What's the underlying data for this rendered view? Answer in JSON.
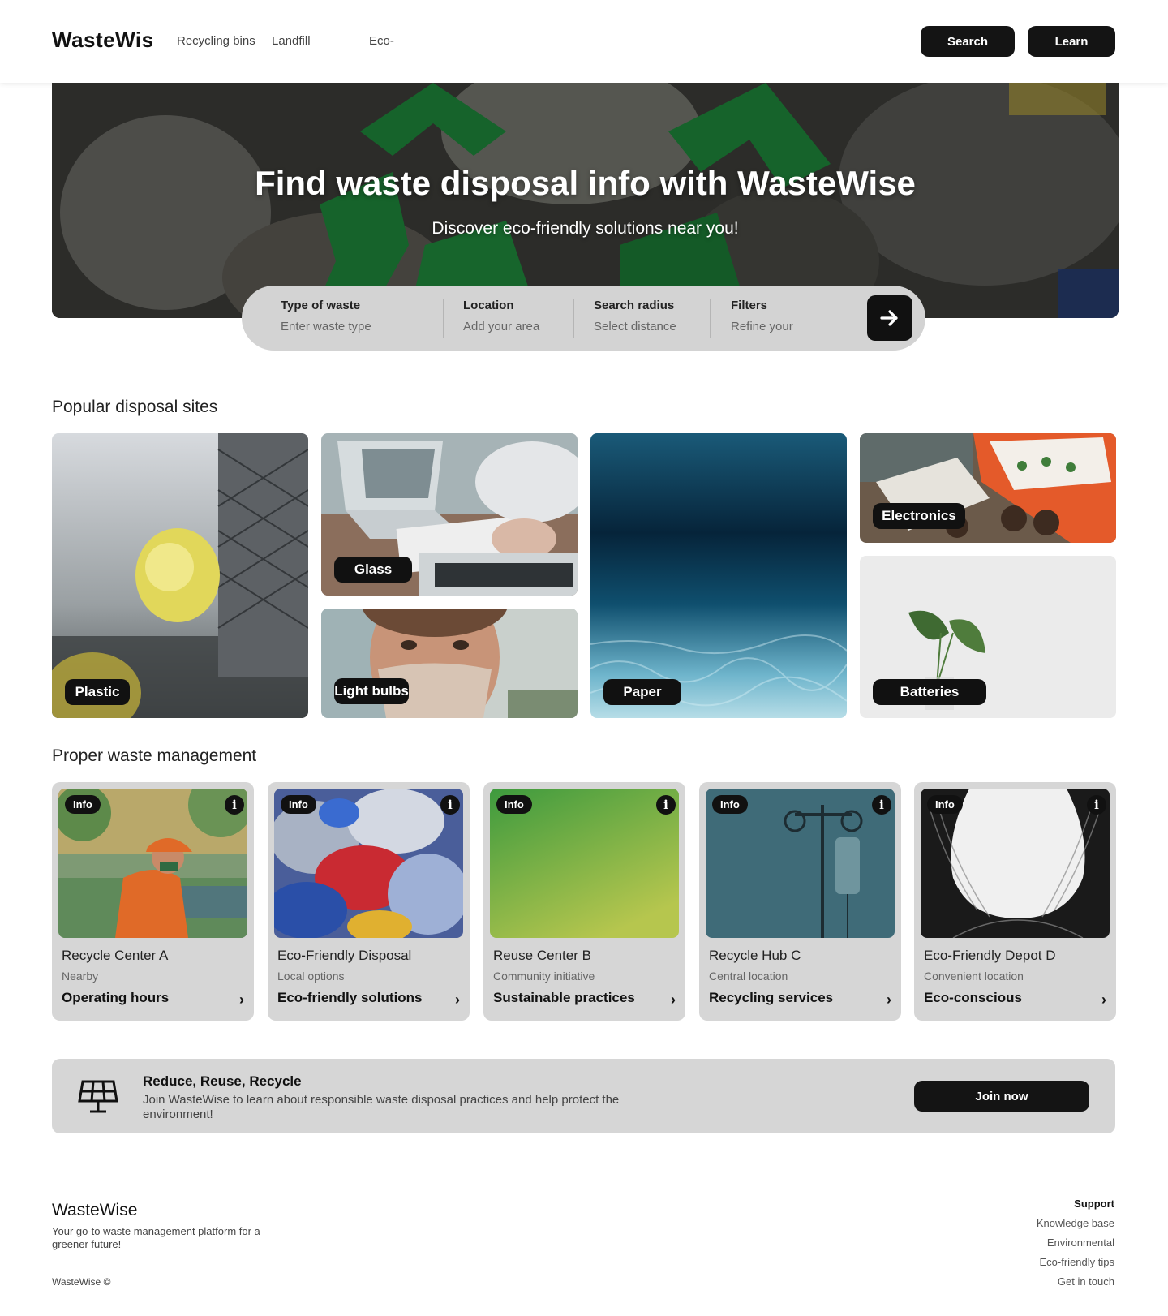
{
  "header": {
    "logo": "WasteWis",
    "nav": [
      "Recycling bins",
      "Landfill",
      "Eco-"
    ],
    "search_label": "Search",
    "learn_label": "Learn"
  },
  "hero": {
    "title": "Find waste disposal info with WasteWise",
    "subtitle": "Discover eco-friendly solutions near you!"
  },
  "search": {
    "fields": [
      {
        "label": "Type of waste",
        "placeholder": "Enter waste type"
      },
      {
        "label": "Location",
        "placeholder": "Add your area"
      },
      {
        "label": "Search radius",
        "placeholder": "Select distance"
      },
      {
        "label": "Filters",
        "placeholder": "Refine your"
      }
    ],
    "button_icon": "arrow-right-icon"
  },
  "popular": {
    "title": "Popular disposal sites",
    "tiles": [
      "Plastic",
      "Glass",
      "Light bulbs",
      "Paper",
      "Electronics",
      "Batteries"
    ]
  },
  "management": {
    "title": "Proper waste management",
    "badge": "Info",
    "cards": [
      {
        "title": "Recycle Center A",
        "subtitle": "Nearby",
        "link": "Operating hours"
      },
      {
        "title": "Eco-Friendly Disposal",
        "subtitle": "Local options",
        "link": "Eco-friendly solutions"
      },
      {
        "title": "Reuse Center B",
        "subtitle": "Community initiative",
        "link": "Sustainable practices"
      },
      {
        "title": "Recycle Hub C",
        "subtitle": "Central location",
        "link": "Recycling services"
      },
      {
        "title": "Eco-Friendly Depot D",
        "subtitle": "Convenient location",
        "link": "Eco-conscious"
      }
    ]
  },
  "cta": {
    "icon": "solar-panel-icon",
    "title": "Reduce, Reuse, Recycle",
    "description": "Join WasteWise to learn about responsible waste disposal practices and help protect the environment!",
    "button": "Join now"
  },
  "footer": {
    "logo": "WasteWise",
    "tagline": "Your go-to waste management platform for a greener future!",
    "copyright": "WasteWise ©",
    "links_heading": "Support",
    "links": [
      "Knowledge base",
      "Environmental",
      "Eco-friendly tips",
      "Get in touch"
    ]
  }
}
